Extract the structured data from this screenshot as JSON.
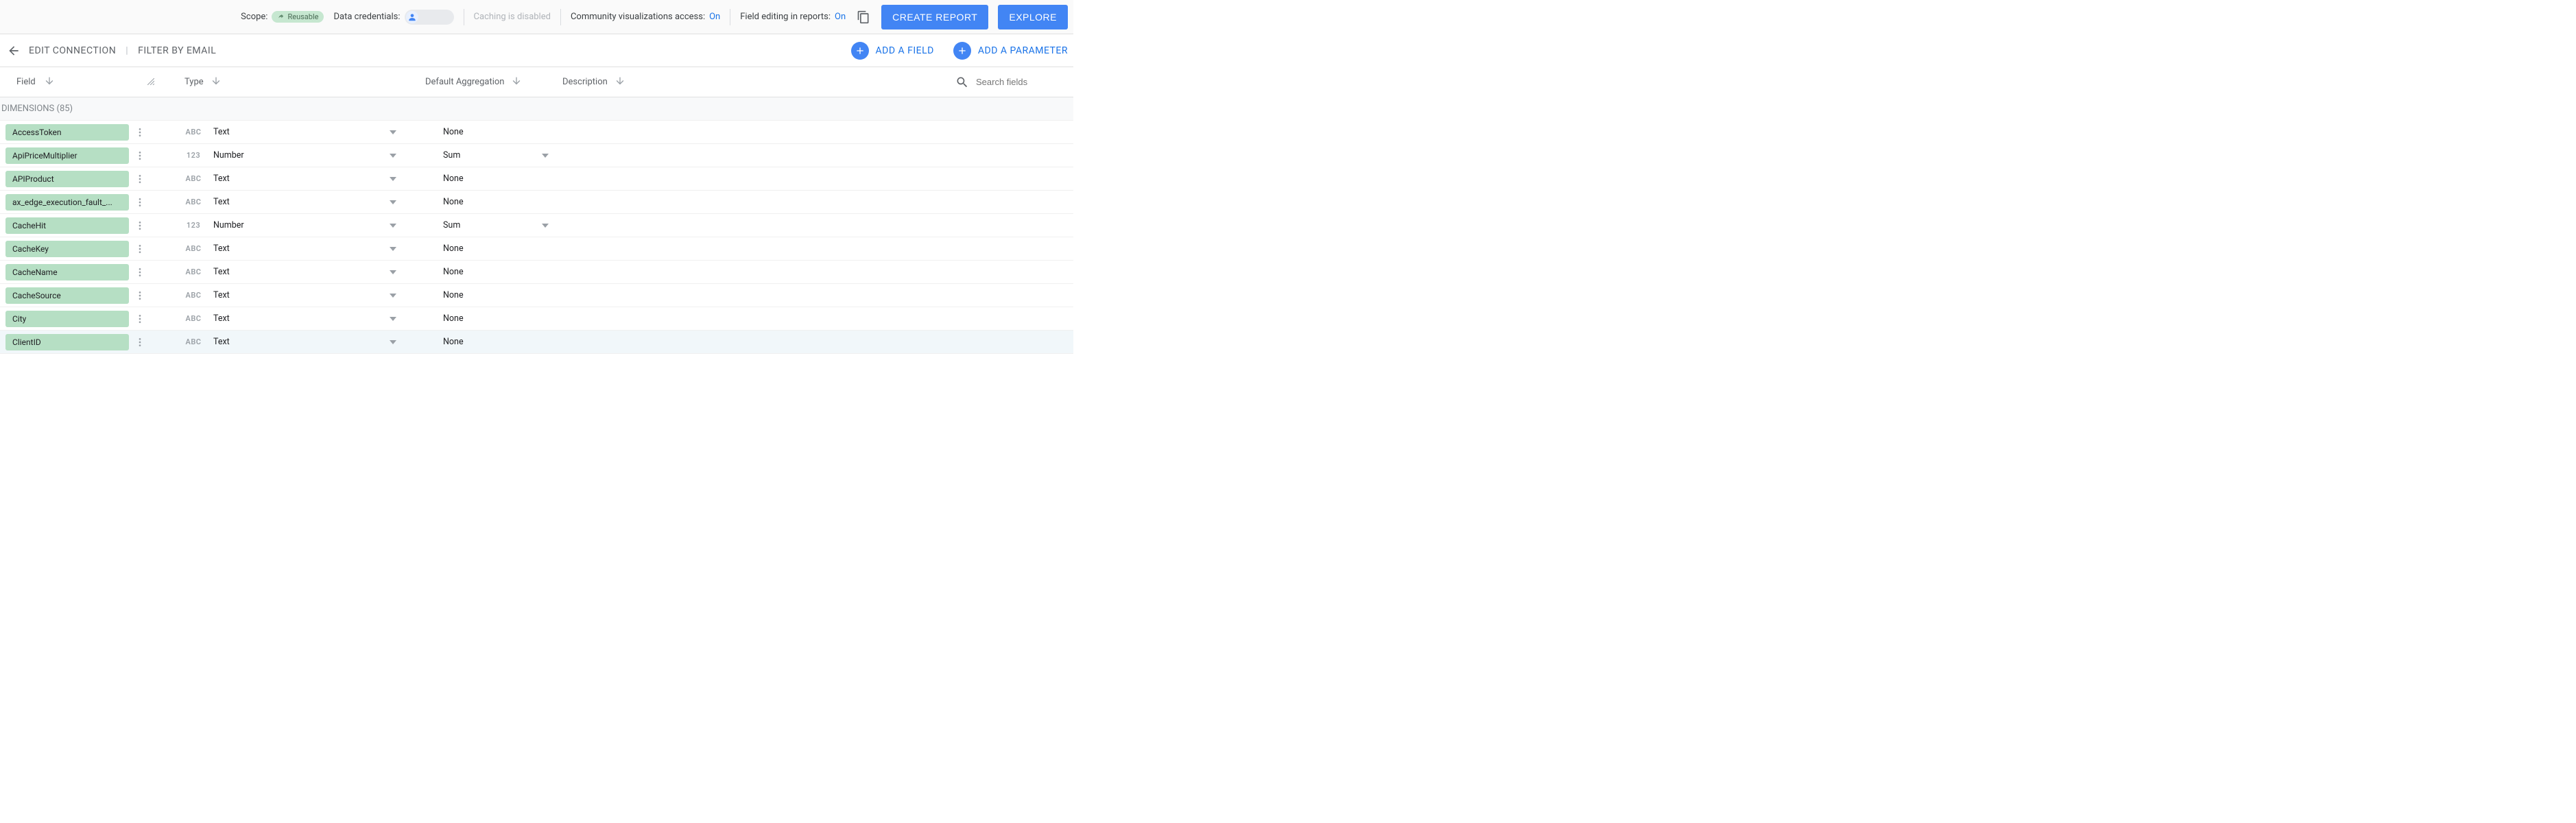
{
  "config": {
    "scope_label": "Scope:",
    "reusable_chip": "Reusable",
    "data_credentials_label": "Data credentials:",
    "caching_text": "Caching is disabled",
    "community_vis_label": "Community visualizations access:",
    "community_vis_value": "On",
    "field_editing_label": "Field editing in reports:",
    "field_editing_value": "On",
    "create_report_btn": "CREATE REPORT",
    "explore_btn": "EXPLORE"
  },
  "breadcrumb": {
    "edit_connection": "EDIT CONNECTION",
    "filter_by_email": "FILTER BY EMAIL"
  },
  "actions": {
    "add_field": "ADD A FIELD",
    "add_parameter": "ADD A PARAMETER"
  },
  "columns": {
    "field": "Field",
    "type": "Type",
    "agg": "Default Aggregation",
    "desc": "Description",
    "search_placeholder": "Search fields"
  },
  "section": "DIMENSIONS (85)",
  "rows": [
    {
      "name": "AccessToken",
      "type_icon": "ABC",
      "type": "Text",
      "agg": "None",
      "agg_drop": false
    },
    {
      "name": "ApiPriceMultiplier",
      "type_icon": "123",
      "type": "Number",
      "agg": "Sum",
      "agg_drop": true
    },
    {
      "name": "APIProduct",
      "type_icon": "ABC",
      "type": "Text",
      "agg": "None",
      "agg_drop": false
    },
    {
      "name": "ax_edge_execution_fault_...",
      "type_icon": "ABC",
      "type": "Text",
      "agg": "None",
      "agg_drop": false
    },
    {
      "name": "CacheHit",
      "type_icon": "123",
      "type": "Number",
      "agg": "Sum",
      "agg_drop": true
    },
    {
      "name": "CacheKey",
      "type_icon": "ABC",
      "type": "Text",
      "agg": "None",
      "agg_drop": false
    },
    {
      "name": "CacheName",
      "type_icon": "ABC",
      "type": "Text",
      "agg": "None",
      "agg_drop": false
    },
    {
      "name": "CacheSource",
      "type_icon": "ABC",
      "type": "Text",
      "agg": "None",
      "agg_drop": false
    },
    {
      "name": "City",
      "type_icon": "ABC",
      "type": "Text",
      "agg": "None",
      "agg_drop": false
    },
    {
      "name": "ClientID",
      "type_icon": "ABC",
      "type": "Text",
      "agg": "None",
      "agg_drop": false
    }
  ]
}
